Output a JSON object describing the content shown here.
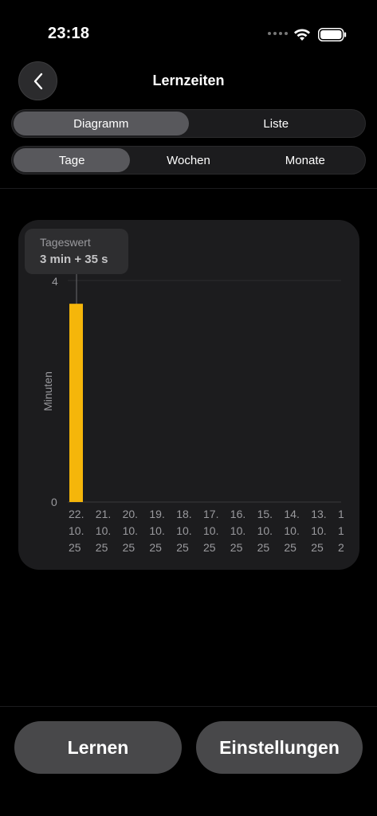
{
  "status_bar": {
    "time": "23:18"
  },
  "nav": {
    "title": "Lernzeiten",
    "back_icon": "chevron-left-icon"
  },
  "view_segment": {
    "items": [
      "Diagramm",
      "Liste"
    ],
    "selected": "Diagramm"
  },
  "period_segment": {
    "items": [
      "Tage",
      "Wochen",
      "Monate"
    ],
    "selected": "Tage"
  },
  "tooltip": {
    "label": "Tageswert",
    "value": "3 min + 35 s"
  },
  "chart_data": {
    "type": "bar",
    "ylabel": "Minuten",
    "ylim": [
      0,
      4
    ],
    "yticks": [
      "4",
      "0"
    ],
    "bar_color": "#f5b60a",
    "categories": [
      [
        "22.",
        "10.",
        "25"
      ],
      [
        "21.",
        "10.",
        "25"
      ],
      [
        "20.",
        "10.",
        "25"
      ],
      [
        "19.",
        "10.",
        "25"
      ],
      [
        "18.",
        "10.",
        "25"
      ],
      [
        "17.",
        "10.",
        "25"
      ],
      [
        "16.",
        "10.",
        "25"
      ],
      [
        "15.",
        "10.",
        "25"
      ],
      [
        "14.",
        "10.",
        "25"
      ],
      [
        "13.",
        "10.",
        "25"
      ],
      [
        "1",
        "1",
        "2"
      ]
    ],
    "values": [
      3.58,
      0,
      0,
      0,
      0,
      0,
      0,
      0,
      0,
      0,
      0
    ],
    "selected_index": 0
  },
  "buttons": {
    "learn": "Lernen",
    "settings": "Einstellungen"
  }
}
